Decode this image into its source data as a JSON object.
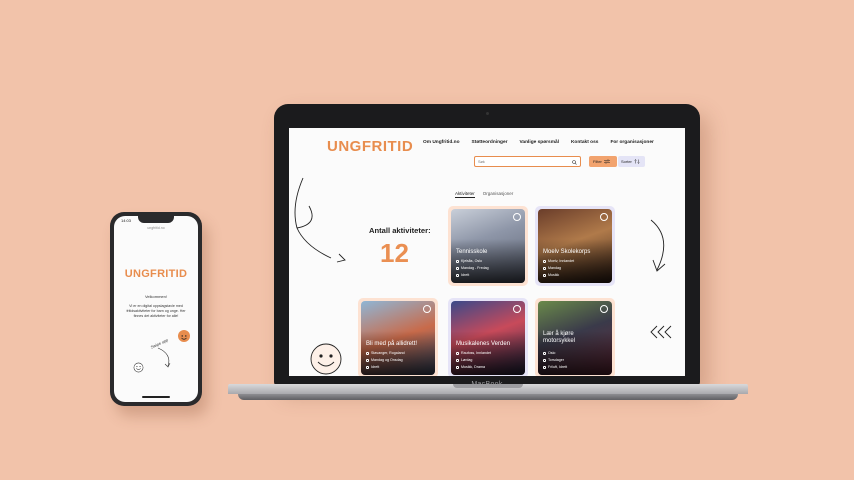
{
  "phone": {
    "time": "14:03",
    "url": "ungfritid.no",
    "logo": "UNGFRITID",
    "welcome": "Velkommen!",
    "intro": "Vi er en digital oppslagstavle med fritidsaktiviteter for barn og unge. Her finnes det aktiviteter for alle!",
    "swipe": "Swipe opp"
  },
  "laptop": {
    "brand": "MacBook"
  },
  "site": {
    "logo": "UNGFRITID",
    "nav": [
      "Om Ungfritid.no",
      "Støtteordninger",
      "Vanlige spørsmål",
      "Kontakt oss",
      "For organisasjoner"
    ],
    "search_placeholder": "Søk",
    "filter_label": "Filter",
    "sort_label": "Sorter",
    "tabs": [
      "Aktiviteter",
      "Organisasjoner"
    ],
    "count_label": "Antall aktiviteter:",
    "count_value": "12",
    "cards": [
      {
        "title": "Tennisskole",
        "place": "Kjelsås, Oslo",
        "time": "Mandag - Fredag",
        "category": "Idrett"
      },
      {
        "title": "Moelv Skolekorps",
        "place": "Moelv, Innlandet",
        "time": "Mandag",
        "category": "Musikk"
      },
      {
        "title": "Bli med på allidrett!",
        "place": "Stavanger, Rogaland",
        "time": "Mandag og Onsdag",
        "category": "Idrett"
      },
      {
        "title": "Musikalenes Verden",
        "place": "Raufoss, Innlandet",
        "time": "Lørdag",
        "category": "Musikk, Drama"
      },
      {
        "title": "Lær å kjøre motorsykkel",
        "place": "Oslo",
        "time": "Torsdager",
        "category": "Friluft, Idrett"
      }
    ]
  },
  "colors": {
    "accent": "#e88d4e",
    "background": "#f2c3aa",
    "sort": "#e4e4f6"
  }
}
